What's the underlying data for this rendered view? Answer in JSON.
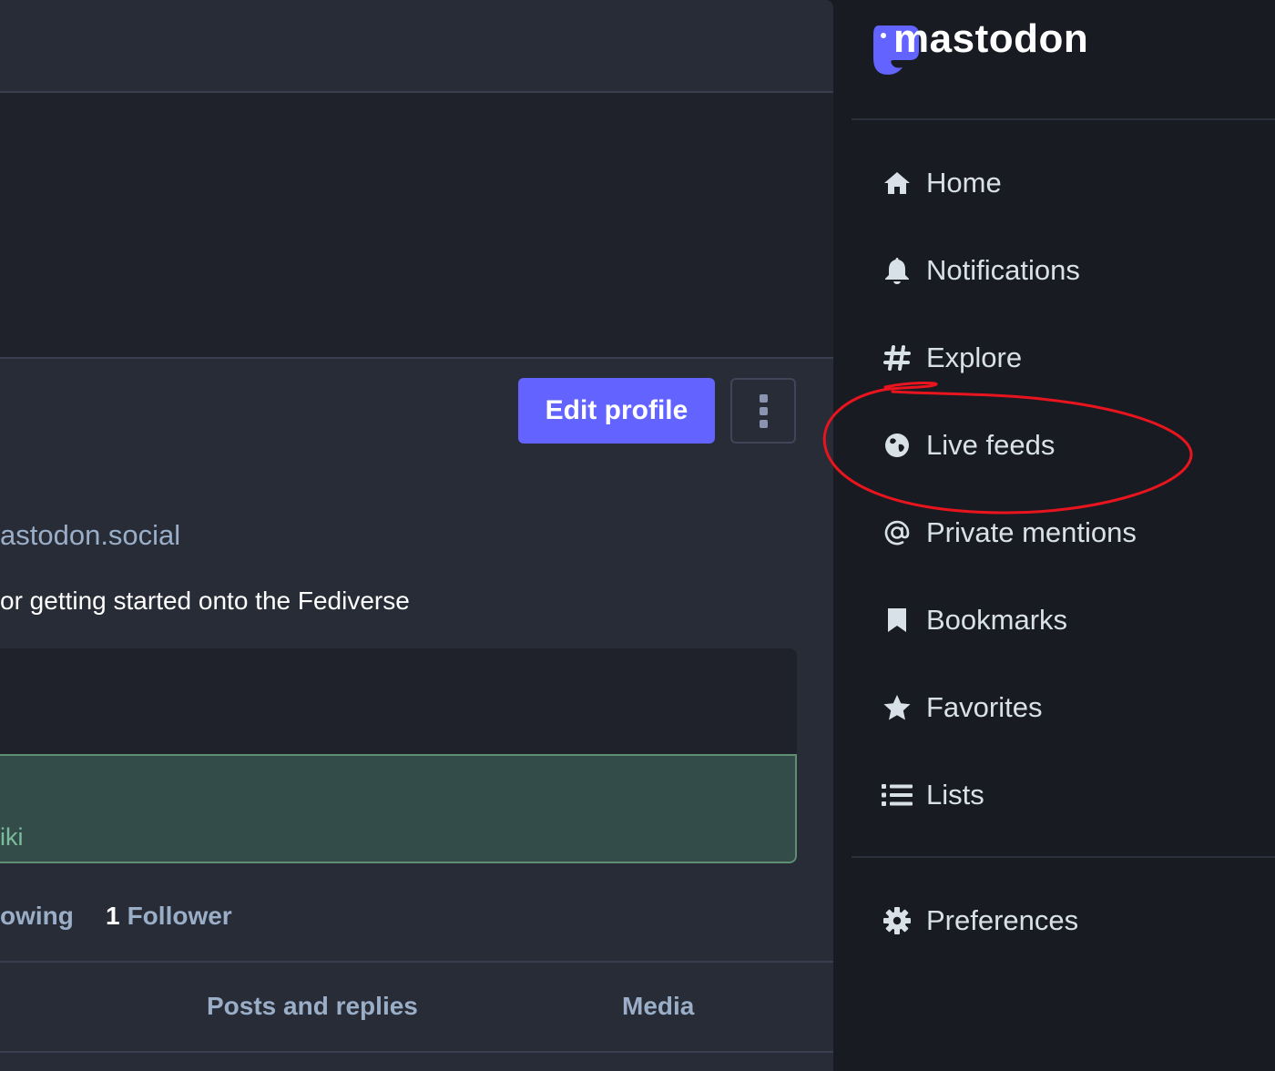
{
  "main": {
    "actions": {
      "edit_profile_label": "Edit profile"
    },
    "profile": {
      "handle": "astodon.social",
      "bio": "or getting started onto the Fediverse"
    },
    "fields": {
      "verified_value": "iki"
    },
    "counts": {
      "following_label": "owing",
      "followers_count": "1",
      "followers_label": "Follower"
    },
    "tabs": [
      {
        "label": "Posts and replies"
      },
      {
        "label": "Media"
      }
    ]
  },
  "nav": {
    "logo_text": "mastodon",
    "items": [
      {
        "label": "Home",
        "icon": "home-icon"
      },
      {
        "label": "Notifications",
        "icon": "bell-icon"
      },
      {
        "label": "Explore",
        "icon": "hashtag-icon"
      },
      {
        "label": "Live feeds",
        "icon": "globe-icon"
      },
      {
        "label": "Private mentions",
        "icon": "at-icon"
      },
      {
        "label": "Bookmarks",
        "icon": "bookmark-icon"
      },
      {
        "label": "Favorites",
        "icon": "star-icon"
      },
      {
        "label": "Lists",
        "icon": "list-icon"
      }
    ],
    "preferences": {
      "label": "Preferences",
      "icon": "gear-icon"
    }
  },
  "colors": {
    "accent": "#6364ff",
    "annotation": "#e8141e",
    "verified_bg": "#344c49",
    "verified_text": "#79bd9a"
  }
}
